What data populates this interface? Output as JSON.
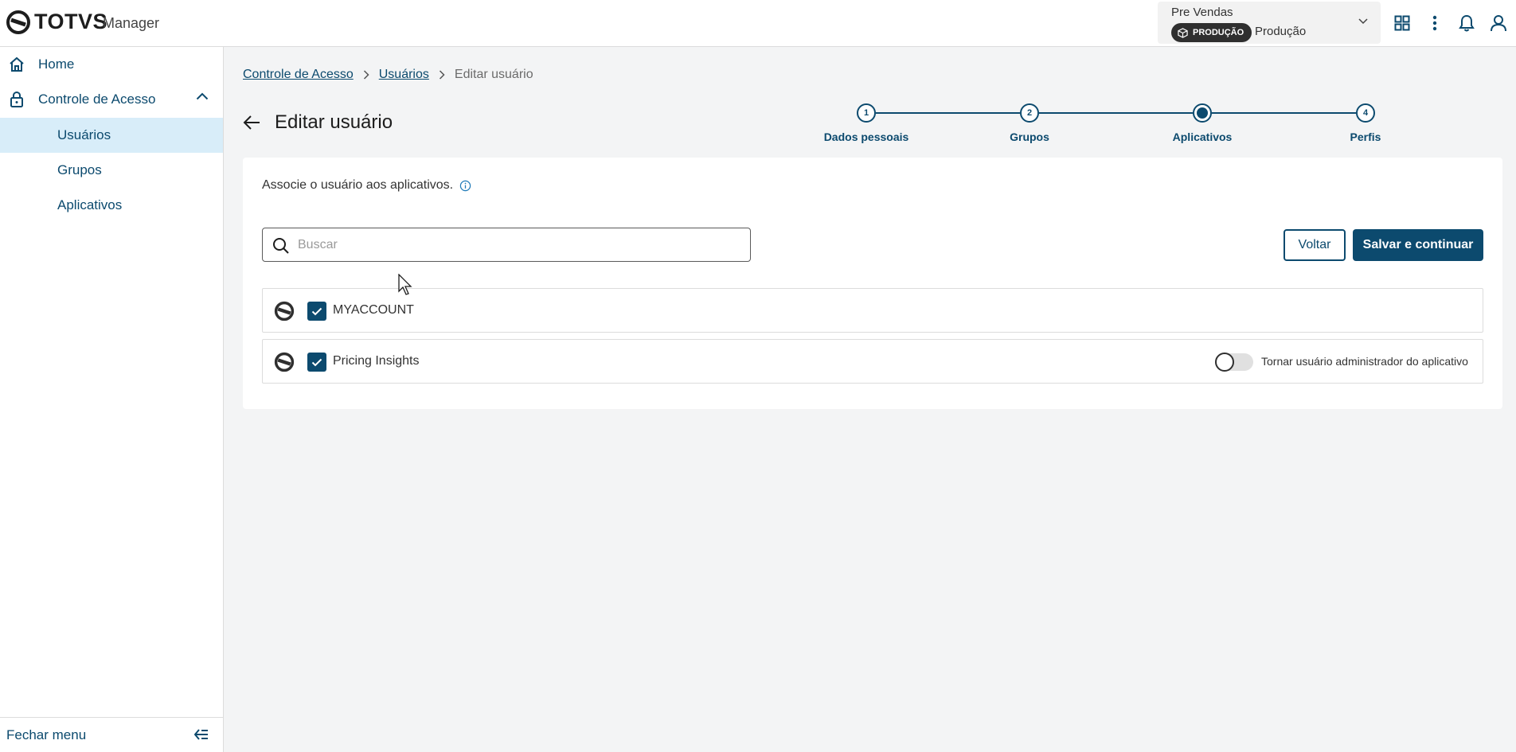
{
  "header": {
    "brand": "TOTVS",
    "app_name": "Manager",
    "env": {
      "title": "Pre Vendas",
      "badge": "PRODUÇÃO",
      "value": "Produção"
    },
    "icons": [
      "apps-grid-icon",
      "more-vertical-icon",
      "bell-icon",
      "user-icon"
    ]
  },
  "sidebar": {
    "items": [
      {
        "label": "Home",
        "icon": "home-icon"
      },
      {
        "label": "Controle de Acesso",
        "icon": "lock-icon"
      }
    ],
    "subitems": [
      {
        "label": "Usuários"
      },
      {
        "label": "Grupos"
      },
      {
        "label": "Aplicativos"
      }
    ],
    "footer": "Fechar menu"
  },
  "breadcrumb": {
    "items": [
      "Controle de Acesso",
      "Usuários"
    ],
    "current": "Editar usuário"
  },
  "page": {
    "title": "Editar usuário"
  },
  "stepper": {
    "steps": [
      {
        "number": "1",
        "label": "Dados pessoais"
      },
      {
        "number": "2",
        "label": "Grupos"
      },
      {
        "number": "",
        "label": "Aplicativos"
      },
      {
        "number": "4",
        "label": "Perfis"
      }
    ],
    "current_step": 3
  },
  "card": {
    "instruction": "Associe o usuário aos aplicativos.",
    "search_placeholder": "Buscar",
    "search_value": "",
    "back_label": "Voltar",
    "save_label": "Salvar e continuar",
    "apps": [
      {
        "name": "MYACCOUNT",
        "checked": true,
        "has_admin_toggle": false
      },
      {
        "name": "Pricing Insights",
        "checked": true,
        "has_admin_toggle": true,
        "admin_toggle_label": "Tornar usuário administrador do aplicativo",
        "admin": false
      }
    ]
  },
  "colors": {
    "primary": "#0c4a6e",
    "active_nav_bg": "#d8edf9",
    "page_bg": "#f3f4f5"
  }
}
